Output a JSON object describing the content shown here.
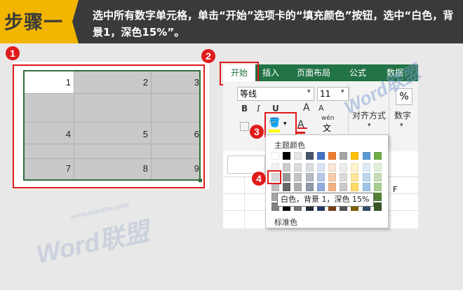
{
  "header": {
    "badge": "步骤一",
    "instruction": "选中所有数字单元格，单击“开始”选项卡的“填充颜色”按钮，选中“白色，背景1，深色15%”。"
  },
  "markers": [
    "1",
    "2",
    "3",
    "4"
  ],
  "grid": {
    "rows": [
      [
        "1",
        "2",
        "3"
      ],
      [
        "4",
        "5",
        "6"
      ],
      [
        "7",
        "8",
        "9"
      ]
    ]
  },
  "ribbon": {
    "tabs": [
      "开始",
      "插入",
      "页面布局",
      "公式",
      "数据"
    ],
    "font_name": "等线",
    "font_size": "11",
    "bold": "B",
    "italic": "I",
    "underline": "U",
    "grow_font": "A",
    "shrink_font": "A",
    "font_color": "A",
    "phonetic": "wén",
    "alignment": "对齐方式",
    "number": "数字",
    "percent": "%"
  },
  "palette": {
    "theme_title": "主题颜色",
    "standard_title": "标准色",
    "theme_colors": [
      "#ffffff",
      "#000000",
      "#e7e6e6",
      "#44546a",
      "#4472c4",
      "#ed7d31",
      "#a5a5a5",
      "#ffc000",
      "#5b9bd5",
      "#70ad47"
    ],
    "tooltip": "白色，背景 1，深色 15%"
  },
  "sheet": {
    "column_label": "F"
  },
  "watermark": {
    "top": "Word联盟",
    "bottom": "Word联盟",
    "bottom_url": "www.wordlm.com"
  }
}
